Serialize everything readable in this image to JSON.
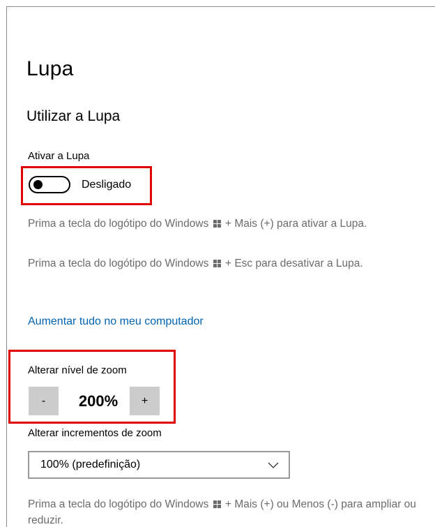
{
  "page": {
    "title": "Lupa",
    "section_title": "Utilizar a Lupa"
  },
  "magnifier_toggle": {
    "label": "Ativar a Lupa",
    "state_text": "Desligado",
    "on": false
  },
  "help": {
    "line1_before": "Prima a tecla do logótipo do Windows",
    "line1_after": "+ Mais (+) para ativar a Lupa.",
    "line2_before": "Prima a tecla do logótipo do Windows",
    "line2_after": "+ Esc para desativar a Lupa."
  },
  "link": {
    "text": "Aumentar tudo no meu computador"
  },
  "zoom": {
    "label": "Alterar nível de zoom",
    "decrease_label": "-",
    "value_text": "200%",
    "increase_label": "+"
  },
  "zoom_increments": {
    "label": "Alterar incrementos de zoom",
    "selected": "100% (predefinição)"
  },
  "footer_help": {
    "before": "Prima a tecla do logótipo do Windows",
    "after": "+ Mais (+) ou Menos (-) para ampliar ou reduzir."
  },
  "icons": {
    "windows_key": "windows-logo-icon",
    "chevron": "chevron-down-icon"
  },
  "colors": {
    "link": "#0063b1",
    "highlight_box": "#e00000",
    "button_bg": "#cccccc",
    "help_text": "#6b6b6b"
  }
}
